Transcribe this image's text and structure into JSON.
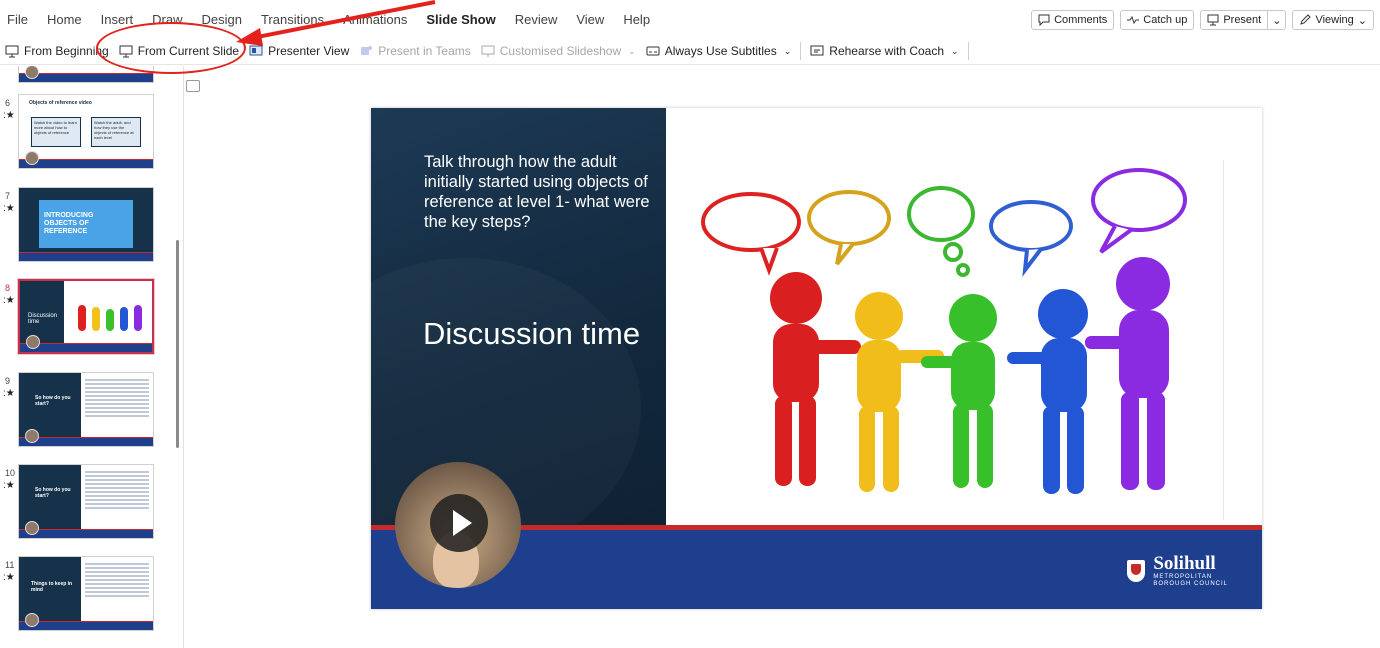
{
  "menu": {
    "items": [
      "File",
      "Home",
      "Insert",
      "Draw",
      "Design",
      "Transitions",
      "Animations",
      "Slide Show",
      "Review",
      "View",
      "Help"
    ],
    "active": "Slide Show",
    "comments_label": "Comments",
    "catchup_label": "Catch up",
    "present_label": "Present",
    "viewing_label": "Viewing"
  },
  "ribbon": {
    "from_beginning": "From Beginning",
    "from_current_slide": "From Current Slide",
    "presenter_view": "Presenter View",
    "present_in_teams": "Present in Teams",
    "customised_slideshow": "Customised Slideshow",
    "always_use_subtitles": "Always Use Subtitles",
    "rehearse_with_coach": "Rehearse with Coach"
  },
  "thumbnails": [
    {
      "number": "6",
      "title": "Objects of reference video",
      "box1": "Watch the video to learn more about how to objects of reference",
      "box2": "Watch the adult, and how they use the objects of reference at each level"
    },
    {
      "number": "7",
      "title": "INTRODUCING OBJECTS OF REFERENCE"
    },
    {
      "number": "8",
      "title": "Discussion time",
      "selected": true
    },
    {
      "number": "9",
      "title": "So how do you start?"
    },
    {
      "number": "10",
      "title": "So how do you start?"
    },
    {
      "number": "11",
      "title": "Things to keep in mind"
    }
  ],
  "slide": {
    "prompt": "Talk through how the adult initially started using objects of reference at level 1- what were the key steps?",
    "heading": "Discussion time",
    "logo_name": "Solihull",
    "logo_sub1": "METROPOLITAN",
    "logo_sub2": "BOROUGH COUNCIL"
  },
  "colors": {
    "accent_red": "#c4314b",
    "slide_dark": "#16314a",
    "footer_blue": "#1e3f8e",
    "annotation_red": "#e4211b"
  }
}
